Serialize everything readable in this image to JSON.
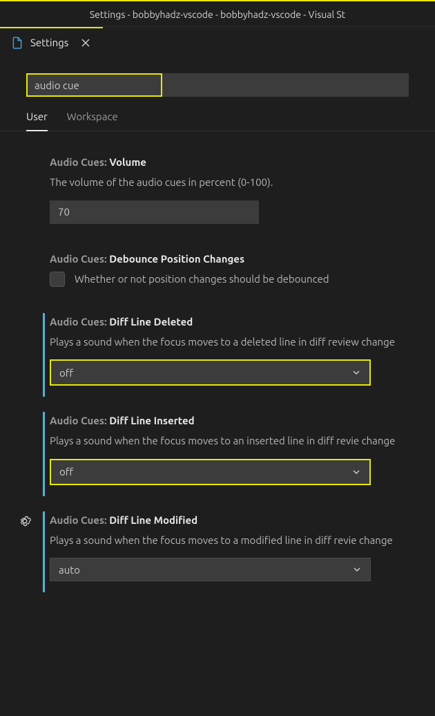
{
  "window": {
    "title": "Settings - bobbyhadz-vscode - bobbyhadz-vscode - Visual St"
  },
  "tab": {
    "label": "Settings"
  },
  "search": {
    "value": "audio cue"
  },
  "scopes": {
    "user": "User",
    "workspace": "Workspace"
  },
  "settings": {
    "volume": {
      "category": "Audio Cues:",
      "name": "Volume",
      "description": "The volume of the audio cues in percent (0-100).",
      "value": "70"
    },
    "debounce": {
      "category": "Audio Cues:",
      "name": "Debounce Position Changes",
      "label": "Whether or not position changes should be debounced"
    },
    "diffDeleted": {
      "category": "Audio Cues:",
      "name": "Diff Line Deleted",
      "description": "Plays a sound when the focus moves to a deleted line in diff review change",
      "value": "off"
    },
    "diffInserted": {
      "category": "Audio Cues:",
      "name": "Diff Line Inserted",
      "description": "Plays a sound when the focus moves to an inserted line in diff revie change",
      "value": "off"
    },
    "diffModified": {
      "category": "Audio Cues:",
      "name": "Diff Line Modified",
      "description": "Plays a sound when the focus moves to a modified line in diff revie change",
      "value": "auto"
    }
  }
}
